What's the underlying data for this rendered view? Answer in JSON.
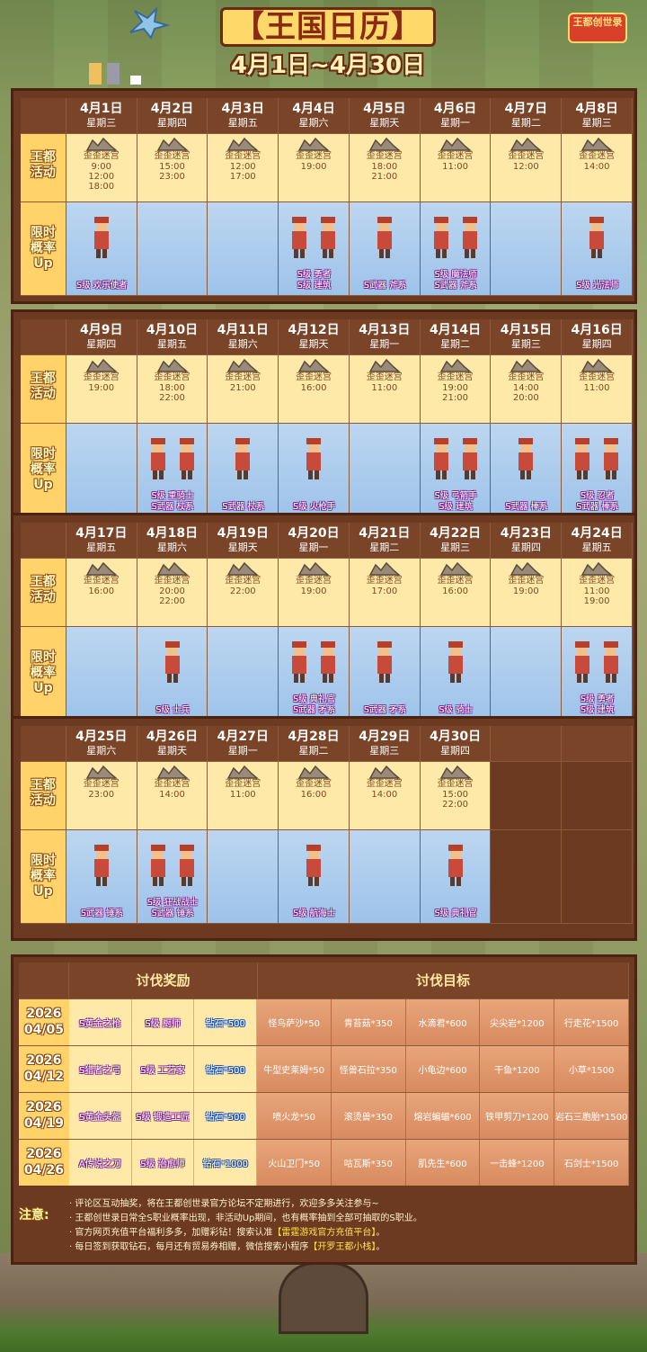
{
  "header": {
    "title": "【王国日历】",
    "subtitle": "4月1日~4月30日",
    "logo_text": "王都创世录"
  },
  "labels": {
    "activity": "王都活动",
    "rate_up": "限时概率Up"
  },
  "weeks": [
    {
      "days": [
        {
          "date": "4月1日",
          "weekday": "星期三",
          "act": "歪歪迷宫",
          "times": "9:00 12:00 18:00",
          "up": "S级 欢乐使者"
        },
        {
          "date": "4月2日",
          "weekday": "星期四",
          "act": "歪歪迷宫",
          "times": "15:00 23:00",
          "up": ""
        },
        {
          "date": "4月3日",
          "weekday": "星期五",
          "act": "歪歪迷宫",
          "times": "12:00 17:00",
          "up": ""
        },
        {
          "date": "4月4日",
          "weekday": "星期六",
          "act": "歪歪迷宫",
          "times": "19:00",
          "up": "S级 勇者\nS级 建筑"
        },
        {
          "date": "4月5日",
          "weekday": "星期天",
          "act": "歪歪迷宫",
          "times": "18:00 21:00",
          "up": "S武器 斧系"
        },
        {
          "date": "4月6日",
          "weekday": "星期一",
          "act": "歪歪迷宫",
          "times": "11:00",
          "up": "S级 魔法师\nS武器 斧系"
        },
        {
          "date": "4月7日",
          "weekday": "星期二",
          "act": "歪歪迷宫",
          "times": "12:00",
          "up": ""
        },
        {
          "date": "4月8日",
          "weekday": "星期三",
          "act": "歪歪迷宫",
          "times": "14:00",
          "up": "S级 光法师"
        }
      ]
    },
    {
      "days": [
        {
          "date": "4月9日",
          "weekday": "星期四",
          "act": "歪歪迷宫",
          "times": "19:00",
          "up": ""
        },
        {
          "date": "4月10日",
          "weekday": "星期五",
          "act": "歪歪迷宫",
          "times": "18:00 22:00",
          "up": "S级 重骑士\nS武器 杖系"
        },
        {
          "date": "4月11日",
          "weekday": "星期六",
          "act": "歪歪迷宫",
          "times": "21:00",
          "up": "S武器 杖系"
        },
        {
          "date": "4月12日",
          "weekday": "星期天",
          "act": "歪歪迷宫",
          "times": "16:00",
          "up": "S级 火枪手"
        },
        {
          "date": "4月13日",
          "weekday": "星期一",
          "act": "歪歪迷宫",
          "times": "11:00",
          "up": ""
        },
        {
          "date": "4月14日",
          "weekday": "星期二",
          "act": "歪歪迷宫",
          "times": "19:00 21:00",
          "up": "S级 弓箭手\nS级 建筑"
        },
        {
          "date": "4月15日",
          "weekday": "星期三",
          "act": "歪歪迷宫",
          "times": "14:00 20:00",
          "up": "S武器 棒系"
        },
        {
          "date": "4月16日",
          "weekday": "星期四",
          "act": "歪歪迷宫",
          "times": "11:00",
          "up": "S级 忍者\nS武器 棒系"
        }
      ]
    },
    {
      "days": [
        {
          "date": "4月17日",
          "weekday": "星期五",
          "act": "歪歪迷宫",
          "times": "16:00",
          "up": ""
        },
        {
          "date": "4月18日",
          "weekday": "星期六",
          "act": "歪歪迷宫",
          "times": "20:00 22:00",
          "up": "S级 士兵"
        },
        {
          "date": "4月19日",
          "weekday": "星期天",
          "act": "歪歪迷宫",
          "times": "22:00",
          "up": ""
        },
        {
          "date": "4月20日",
          "weekday": "星期一",
          "act": "歪歪迷宫",
          "times": "19:00",
          "up": "S级 典礼官\nS武器 矛系"
        },
        {
          "date": "4月21日",
          "weekday": "星期二",
          "act": "歪歪迷宫",
          "times": "17:00",
          "up": "S武器 矛系"
        },
        {
          "date": "4月22日",
          "weekday": "星期三",
          "act": "歪歪迷宫",
          "times": "16:00",
          "up": "S级 骑士"
        },
        {
          "date": "4月23日",
          "weekday": "星期四",
          "act": "歪歪迷宫",
          "times": "19:00",
          "up": ""
        },
        {
          "date": "4月24日",
          "weekday": "星期五",
          "act": "歪歪迷宫",
          "times": "11:00 19:00",
          "up": "S级 勇者\nS级 建筑"
        }
      ]
    },
    {
      "days": [
        {
          "date": "4月25日",
          "weekday": "星期六",
          "act": "歪歪迷宫",
          "times": "23:00",
          "up": "S武器 锤系"
        },
        {
          "date": "4月26日",
          "weekday": "星期天",
          "act": "歪歪迷宫",
          "times": "14:00",
          "up": "S级 狂战战士\nS武器 锤系"
        },
        {
          "date": "4月27日",
          "weekday": "星期一",
          "act": "歪歪迷宫",
          "times": "11:00",
          "up": ""
        },
        {
          "date": "4月28日",
          "weekday": "星期二",
          "act": "歪歪迷宫",
          "times": "16:00",
          "up": "S级 航海士"
        },
        {
          "date": "4月29日",
          "weekday": "星期三",
          "act": "歪歪迷宫",
          "times": "14:00",
          "up": ""
        },
        {
          "date": "4月30日",
          "weekday": "星期四",
          "act": "歪歪迷宫",
          "times": "15:00 22:00",
          "up": "S级 典礼官"
        },
        {
          "date": "",
          "weekday": "",
          "act": "",
          "times": "",
          "up": ""
        },
        {
          "date": "",
          "weekday": "",
          "act": "",
          "times": "",
          "up": ""
        }
      ]
    }
  ],
  "reward": {
    "header_rewards": "讨伐奖励",
    "header_targets": "讨伐目标",
    "rows": [
      {
        "date": "2026\n04/05",
        "rewards": [
          "S黄金之枪",
          "S级 厨师",
          "钻石*500"
        ],
        "targets": [
          "怪鸟萨沙*50",
          "青苔菇*350",
          "水滴君*600",
          "尖尖岩*1200",
          "行走花*1500"
        ]
      },
      {
        "date": "2026\n04/12",
        "rewards": [
          "S猎者之弓",
          "S级 工艺家",
          "钻石*500"
        ],
        "targets": [
          "牛型史莱姆*50",
          "怪兽石拉*350",
          "小龟边*600",
          "干鱼*1200",
          "小草*1500"
        ]
      },
      {
        "date": "2026\n04/19",
        "rewards": [
          "S黄金头盔",
          "S级 锻造工匠",
          "钻石*500"
        ],
        "targets": [
          "喷火龙*50",
          "滚烫兽*350",
          "熔岩蝙蝠*600",
          "铁甲剪刀*1200",
          "岩石三胞胎*1500"
        ]
      },
      {
        "date": "2026\n04/26",
        "rewards": [
          "A传说之刀",
          "S级 治愈师",
          "钻石*1000"
        ],
        "targets": [
          "火山卫门*50",
          "咕瓦斯*350",
          "肌先生*600",
          "一击蜂*1200",
          "石剑士*1500"
        ]
      }
    ]
  },
  "notes": {
    "label": "注意:",
    "items": [
      "· 评论区互动抽奖，将在王都创世录官方论坛不定期进行，欢迎多多关注参与~",
      "· 王都创世录日常全S职业概率出现，非活动Up期间，也有概率抽到全部可抽取的S职业。",
      "· 官方网页充值平台福利多多，加赠彩钻！搜索认准【雷霆游戏官方充值平台】。",
      "· 每日签到获取钻石，每月还有贸易券相赠，微信搜索小程序【开罗王都小栈】。"
    ]
  },
  "colors": {
    "frame": "#6b3a20",
    "activity_bg": "#ffe9a8",
    "up_bg": "#9ec3ea",
    "target_bg": "#e8a67a"
  }
}
